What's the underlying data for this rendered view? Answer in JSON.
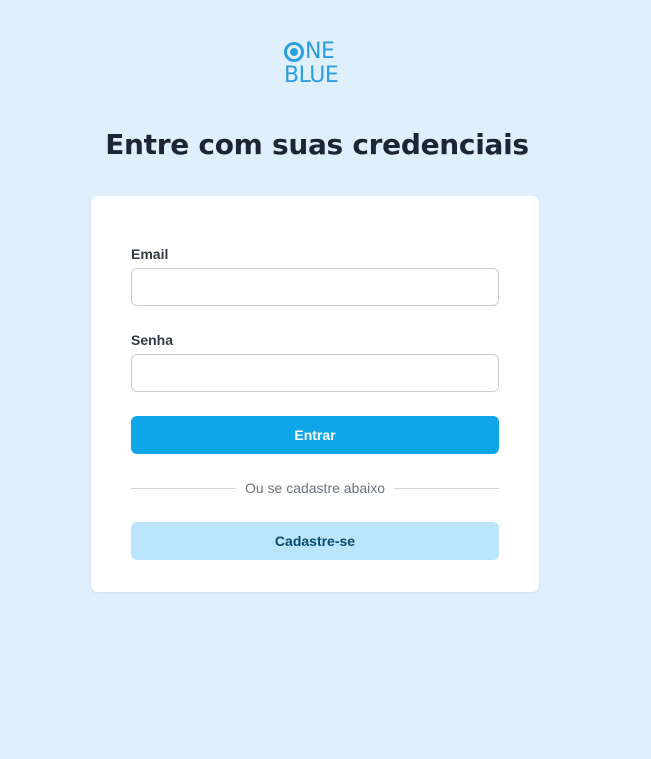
{
  "logo": {
    "line1_rest": "NE",
    "line2": "BLUE",
    "color": "#2b9ee0"
  },
  "page": {
    "headline": "Entre com suas credenciais"
  },
  "form": {
    "email_label": "Email",
    "email_value": "",
    "password_label": "Senha",
    "password_value": "",
    "submit_label": "Entrar",
    "divider_text": "Ou se cadastre abaixo",
    "register_label": "Cadastre-se"
  },
  "colors": {
    "background": "#dff0fc",
    "primary_button": "#0ea5e9",
    "secondary_button": "#bae6fd",
    "heading": "#1d2433"
  }
}
